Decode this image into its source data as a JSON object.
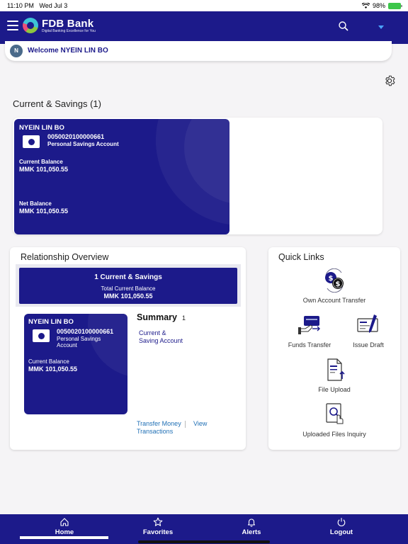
{
  "status_bar": {
    "time": "11:10 PM",
    "date": "Wed Jul 3",
    "battery": "98%"
  },
  "app_bar": {
    "brand_name": "FDB Bank",
    "brand_tagline": "Digital Banking Excellence for You"
  },
  "welcome": {
    "avatar_initial": "N",
    "text": "Welcome NYEIN LIN BO"
  },
  "current_savings": {
    "title": "Current & Savings (1)",
    "card": {
      "holder": "NYEIN LIN BO",
      "account_number": "0050020100000661",
      "account_type": "Personal Savings Account",
      "current_balance_label": "Current Balance",
      "current_balance": "MMK 101,050.55",
      "net_balance_label": "Net Balance",
      "net_balance": "MMK 101,050.55"
    }
  },
  "relationship_overview": {
    "title": "Relationship Overview",
    "summary_banner": {
      "heading": "1 Current & Savings",
      "label": "Total Current Balance",
      "amount": "MMK 101,050.55"
    },
    "card": {
      "holder": "NYEIN LIN BO",
      "account_number": "0050020100000661",
      "account_type_line1": "Personal Savings",
      "account_type_line2": "Account",
      "balance_label": "Current Balance",
      "balance": "MMK 101,050.55"
    },
    "summary": {
      "title": "Summary",
      "count": "1",
      "link_line1": "Current &",
      "link_line2": "Saving Account"
    },
    "actions": {
      "transfer": "Transfer Money",
      "view_line1": "View",
      "view_line2": "Transactions"
    }
  },
  "quick_links": {
    "title": "Quick Links",
    "items": [
      {
        "label": "Own Account Transfer",
        "icon": "own-account-transfer-icon"
      },
      {
        "label": "Funds Transfer",
        "icon": "funds-transfer-icon"
      },
      {
        "label": "Issue Draft",
        "icon": "issue-draft-icon"
      },
      {
        "label": "File Upload",
        "icon": "file-upload-icon"
      },
      {
        "label": "Uploaded Files Inquiry",
        "icon": "uploaded-files-inquiry-icon"
      }
    ]
  },
  "bottom_nav": {
    "items": [
      {
        "label": "Home",
        "icon": "home-icon",
        "active": true
      },
      {
        "label": "Favorites",
        "icon": "star-icon",
        "active": false
      },
      {
        "label": "Alerts",
        "icon": "bell-icon",
        "active": false
      },
      {
        "label": "Logout",
        "icon": "power-icon",
        "active": false
      }
    ]
  },
  "colors": {
    "brand": "#1c1a8a",
    "link": "#1f6fb5",
    "background": "#f5f4f6",
    "accent_blue": "#4aa3ff"
  }
}
